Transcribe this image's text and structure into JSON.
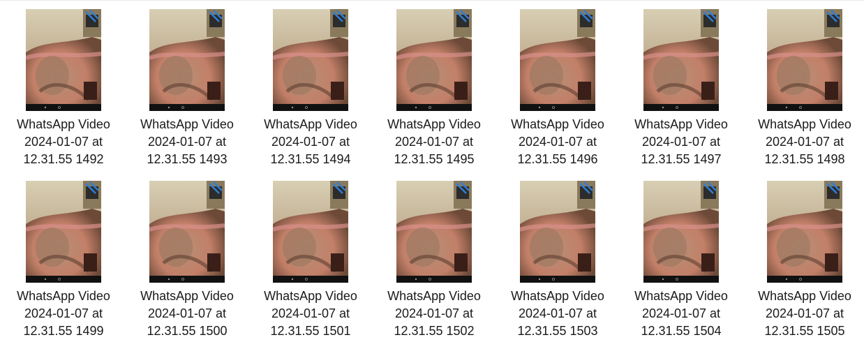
{
  "files": [
    {
      "line1": "WhatsApp Video",
      "line2": "2024-01-07 at",
      "line3": "12.31.55 1492",
      "icon": "video-thumbnail-icon"
    },
    {
      "line1": "WhatsApp Video",
      "line2": "2024-01-07 at",
      "line3": "12.31.55 1493",
      "icon": "video-thumbnail-icon"
    },
    {
      "line1": "WhatsApp Video",
      "line2": "2024-01-07 at",
      "line3": "12.31.55 1494",
      "icon": "video-thumbnail-icon"
    },
    {
      "line1": "WhatsApp Video",
      "line2": "2024-01-07 at",
      "line3": "12.31.55 1495",
      "icon": "video-thumbnail-icon"
    },
    {
      "line1": "WhatsApp Video",
      "line2": "2024-01-07 at",
      "line3": "12.31.55 1496",
      "icon": "video-thumbnail-icon"
    },
    {
      "line1": "WhatsApp Video",
      "line2": "2024-01-07 at",
      "line3": "12.31.55 1497",
      "icon": "video-thumbnail-icon"
    },
    {
      "line1": "WhatsApp Video",
      "line2": "2024-01-07 at",
      "line3": "12.31.55 1498",
      "icon": "video-thumbnail-icon"
    },
    {
      "line1": "WhatsApp Video",
      "line2": "2024-01-07 at",
      "line3": "12.31.55 1499",
      "icon": "video-thumbnail-icon"
    },
    {
      "line1": "WhatsApp Video",
      "line2": "2024-01-07 at",
      "line3": "12.31.55 1500",
      "icon": "video-thumbnail-icon"
    },
    {
      "line1": "WhatsApp Video",
      "line2": "2024-01-07 at",
      "line3": "12.31.55 1501",
      "icon": "video-thumbnail-icon"
    },
    {
      "line1": "WhatsApp Video",
      "line2": "2024-01-07 at",
      "line3": "12.31.55 1502",
      "icon": "video-thumbnail-icon"
    },
    {
      "line1": "WhatsApp Video",
      "line2": "2024-01-07 at",
      "line3": "12.31.55 1503",
      "icon": "video-thumbnail-icon"
    },
    {
      "line1": "WhatsApp Video",
      "line2": "2024-01-07 at",
      "line3": "12.31.55 1504",
      "icon": "video-thumbnail-icon"
    },
    {
      "line1": "WhatsApp Video",
      "line2": "2024-01-07 at",
      "line3": "12.31.55 1505",
      "icon": "video-thumbnail-icon"
    }
  ],
  "colors": {
    "caption_text": "#1a1a1a",
    "background": "#ffffff",
    "thumb_wall": "#d9c9a8",
    "thumb_skin": "#c48a6a",
    "thumb_bar": "#111111",
    "thumb_accent": "#2f7fd6"
  }
}
